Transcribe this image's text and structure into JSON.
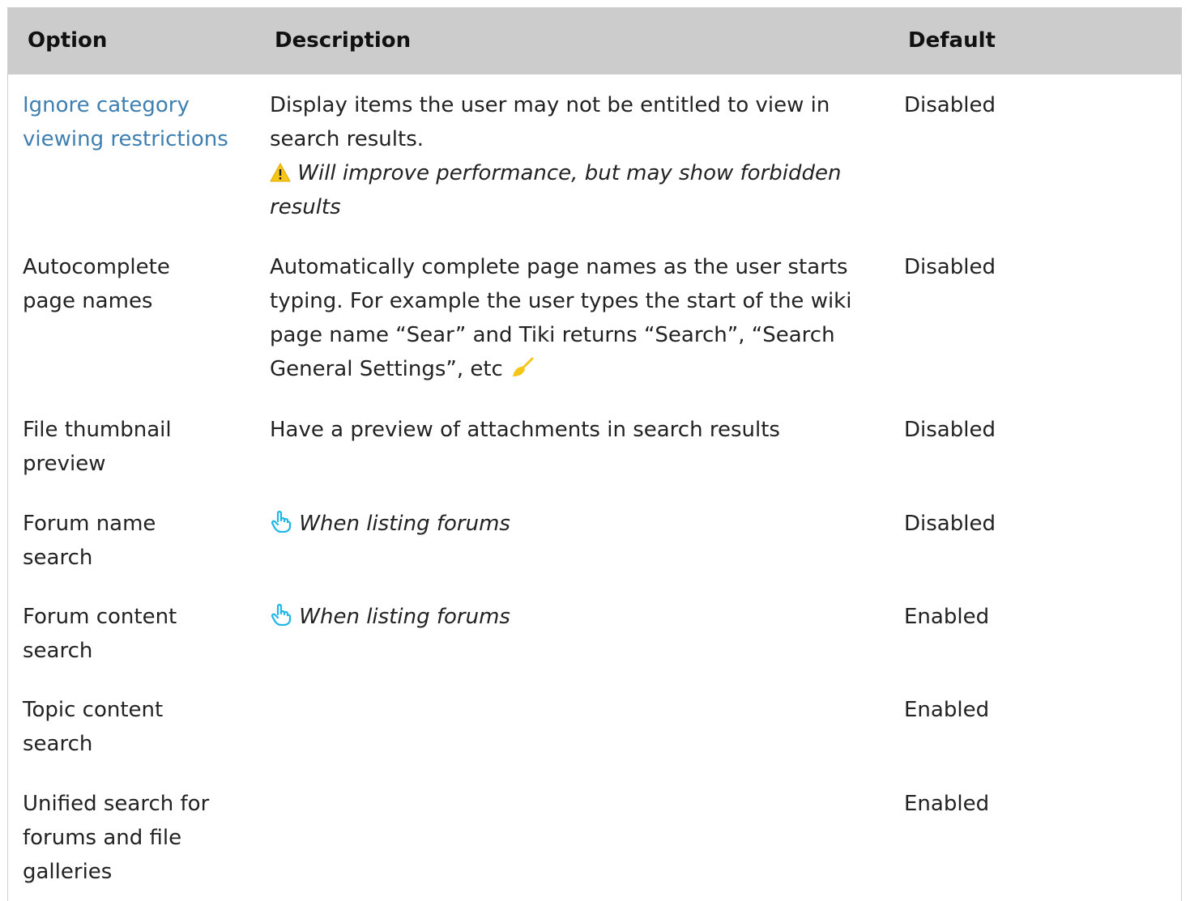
{
  "header": {
    "option": "Option",
    "description": "Description",
    "default": "Default"
  },
  "colors": {
    "header_bg": "#cccccc",
    "link": "#3e7fb1",
    "warning_icon": "#f5c518",
    "pointer_icon": "#1fb6e8",
    "broom_icon": "#f5c518"
  },
  "rows": [
    {
      "option": "Ignore category viewing restrictions",
      "description": "Display items the user may not be entitled to view in search results.",
      "note": "Will improve performance, but may show forbidden results",
      "note_icon": "warning-icon",
      "default": "Disabled"
    },
    {
      "option": "Autocomplete page names",
      "description": "Automatically complete page names as the user starts typing. For example the user types the start of the wiki page name “Sear” and Tiki returns “Search”, “Search General Settings”, etc",
      "trailing_icon": "broom-icon",
      "default": "Disabled"
    },
    {
      "option": "File thumbnail preview",
      "description": "Have a preview of attachments in search results",
      "default": "Disabled"
    },
    {
      "option": "Forum name search",
      "description": "When listing forums",
      "description_icon": "pointing-hand-icon",
      "default": "Disabled"
    },
    {
      "option": "Forum content search",
      "description": "When listing forums",
      "description_icon": "pointing-hand-icon",
      "default": "Enabled"
    },
    {
      "option": "Topic content search",
      "description": "",
      "default": "Enabled"
    },
    {
      "option": "Unified search for forums and file galleries",
      "description": "",
      "default": "Enabled"
    }
  ]
}
